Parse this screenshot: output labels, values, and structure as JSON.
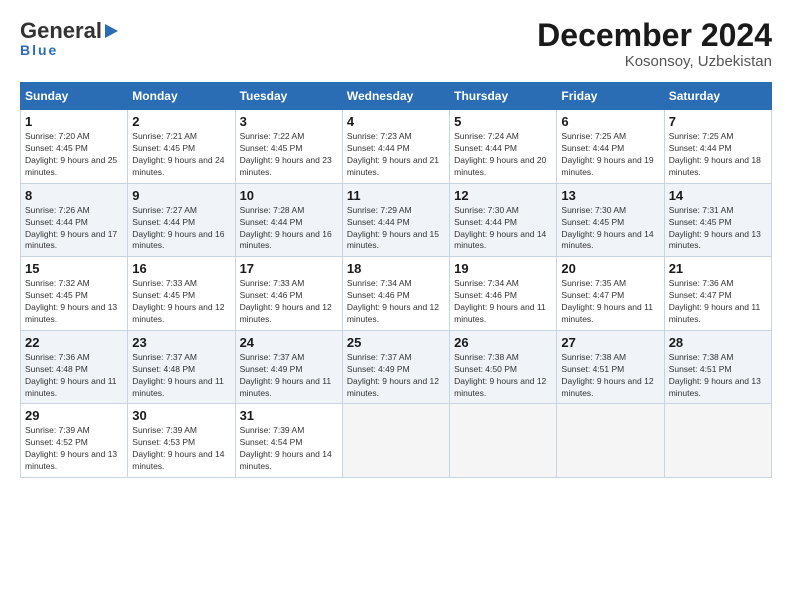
{
  "logo": {
    "general": "General",
    "blue": "Blue"
  },
  "header": {
    "month": "December 2024",
    "location": "Kosonsoy, Uzbekistan"
  },
  "days_of_week": [
    "Sunday",
    "Monday",
    "Tuesday",
    "Wednesday",
    "Thursday",
    "Friday",
    "Saturday"
  ],
  "weeks": [
    [
      {
        "day": "1",
        "sunrise": "7:20 AM",
        "sunset": "4:45 PM",
        "daylight": "9 hours and 25 minutes."
      },
      {
        "day": "2",
        "sunrise": "7:21 AM",
        "sunset": "4:45 PM",
        "daylight": "9 hours and 24 minutes."
      },
      {
        "day": "3",
        "sunrise": "7:22 AM",
        "sunset": "4:45 PM",
        "daylight": "9 hours and 23 minutes."
      },
      {
        "day": "4",
        "sunrise": "7:23 AM",
        "sunset": "4:44 PM",
        "daylight": "9 hours and 21 minutes."
      },
      {
        "day": "5",
        "sunrise": "7:24 AM",
        "sunset": "4:44 PM",
        "daylight": "9 hours and 20 minutes."
      },
      {
        "day": "6",
        "sunrise": "7:25 AM",
        "sunset": "4:44 PM",
        "daylight": "9 hours and 19 minutes."
      },
      {
        "day": "7",
        "sunrise": "7:25 AM",
        "sunset": "4:44 PM",
        "daylight": "9 hours and 18 minutes."
      }
    ],
    [
      {
        "day": "8",
        "sunrise": "7:26 AM",
        "sunset": "4:44 PM",
        "daylight": "9 hours and 17 minutes."
      },
      {
        "day": "9",
        "sunrise": "7:27 AM",
        "sunset": "4:44 PM",
        "daylight": "9 hours and 16 minutes."
      },
      {
        "day": "10",
        "sunrise": "7:28 AM",
        "sunset": "4:44 PM",
        "daylight": "9 hours and 16 minutes."
      },
      {
        "day": "11",
        "sunrise": "7:29 AM",
        "sunset": "4:44 PM",
        "daylight": "9 hours and 15 minutes."
      },
      {
        "day": "12",
        "sunrise": "7:30 AM",
        "sunset": "4:44 PM",
        "daylight": "9 hours and 14 minutes."
      },
      {
        "day": "13",
        "sunrise": "7:30 AM",
        "sunset": "4:45 PM",
        "daylight": "9 hours and 14 minutes."
      },
      {
        "day": "14",
        "sunrise": "7:31 AM",
        "sunset": "4:45 PM",
        "daylight": "9 hours and 13 minutes."
      }
    ],
    [
      {
        "day": "15",
        "sunrise": "7:32 AM",
        "sunset": "4:45 PM",
        "daylight": "9 hours and 13 minutes."
      },
      {
        "day": "16",
        "sunrise": "7:33 AM",
        "sunset": "4:45 PM",
        "daylight": "9 hours and 12 minutes."
      },
      {
        "day": "17",
        "sunrise": "7:33 AM",
        "sunset": "4:46 PM",
        "daylight": "9 hours and 12 minutes."
      },
      {
        "day": "18",
        "sunrise": "7:34 AM",
        "sunset": "4:46 PM",
        "daylight": "9 hours and 12 minutes."
      },
      {
        "day": "19",
        "sunrise": "7:34 AM",
        "sunset": "4:46 PM",
        "daylight": "9 hours and 11 minutes."
      },
      {
        "day": "20",
        "sunrise": "7:35 AM",
        "sunset": "4:47 PM",
        "daylight": "9 hours and 11 minutes."
      },
      {
        "day": "21",
        "sunrise": "7:36 AM",
        "sunset": "4:47 PM",
        "daylight": "9 hours and 11 minutes."
      }
    ],
    [
      {
        "day": "22",
        "sunrise": "7:36 AM",
        "sunset": "4:48 PM",
        "daylight": "9 hours and 11 minutes."
      },
      {
        "day": "23",
        "sunrise": "7:37 AM",
        "sunset": "4:48 PM",
        "daylight": "9 hours and 11 minutes."
      },
      {
        "day": "24",
        "sunrise": "7:37 AM",
        "sunset": "4:49 PM",
        "daylight": "9 hours and 11 minutes."
      },
      {
        "day": "25",
        "sunrise": "7:37 AM",
        "sunset": "4:49 PM",
        "daylight": "9 hours and 12 minutes."
      },
      {
        "day": "26",
        "sunrise": "7:38 AM",
        "sunset": "4:50 PM",
        "daylight": "9 hours and 12 minutes."
      },
      {
        "day": "27",
        "sunrise": "7:38 AM",
        "sunset": "4:51 PM",
        "daylight": "9 hours and 12 minutes."
      },
      {
        "day": "28",
        "sunrise": "7:38 AM",
        "sunset": "4:51 PM",
        "daylight": "9 hours and 13 minutes."
      }
    ],
    [
      {
        "day": "29",
        "sunrise": "7:39 AM",
        "sunset": "4:52 PM",
        "daylight": "9 hours and 13 minutes."
      },
      {
        "day": "30",
        "sunrise": "7:39 AM",
        "sunset": "4:53 PM",
        "daylight": "9 hours and 14 minutes."
      },
      {
        "day": "31",
        "sunrise": "7:39 AM",
        "sunset": "4:54 PM",
        "daylight": "9 hours and 14 minutes."
      },
      null,
      null,
      null,
      null
    ]
  ],
  "labels": {
    "sunrise": "Sunrise:",
    "sunset": "Sunset:",
    "daylight": "Daylight:"
  }
}
